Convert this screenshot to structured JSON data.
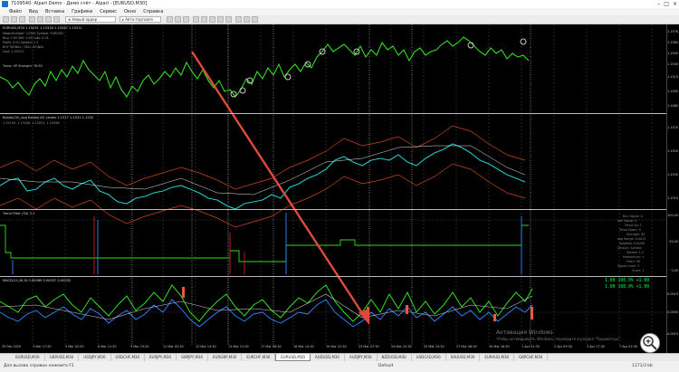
{
  "window": {
    "title": "7109540: Alpari Demo - Демо счёт - Alpari - [EURUSD,M30]",
    "buttons": [
      "–",
      "□",
      "×"
    ]
  },
  "menu": [
    "Файл",
    "Вид",
    "Вставка",
    "Графики",
    "Сервис",
    "Окно",
    "Справка"
  ],
  "toolbar": {
    "field1": "⊕ Новый ордер",
    "field2": "▸ Авто-торговля"
  },
  "panes": {
    "main_title": "EURUSD,M30  1.15291 1.15326 1.15287 1.15311",
    "main_info": [
      "MagicNumber: 12345  Symbol: EURUSD",
      "Buy: 0.00  Sell: 0.00  Lots: 0.01",
      "Profit: 0.00  Spread: 1.2",
      "BUY SIGNAL  / SELL SIGNAL",
      "Last: 1.15311",
      "Trend: UP  Strength: 78.63"
    ],
    "pane2_title": "Bands(20)_Avg  Bands(20) Levels  1.1517  1.1531  1.1532",
    "pane2_info": "1.15192, 1.15358, 1.15251, 1.15398",
    "pane3_title": "Trend Filter (30)  3 1",
    "pane3_legend": [
      "Buy Signal: 0",
      "Sell Signal: 0",
      "Trend Up: 1",
      "Trend Down: 0",
      "Strength: 62",
      "Avg Range: 0.0012",
      "Volatility: 0.0008",
      "Session: London",
      "Spread: 1.2",
      "Momentum: +",
      "Filter: OK",
      "Signal Level: 3",
      "Score: 1"
    ],
    "pane4_title": "MACD(12,26,9)  0.00089  0.00057  0.00032",
    "osc_values": [
      "1.00  100.0%  +1.00",
      "1.00  100.0%  +1.00"
    ]
  },
  "price_scale": [
    "1.1576",
    "1.1560",
    "1.1545",
    "1.1530",
    "1.1515",
    "1.1500",
    "1.1485"
  ],
  "pane2_scale": [
    "1.1570",
    "1.1550",
    "1.1530",
    "1.1510"
  ],
  "pane3_scale": [
    "100.00",
    "50.00",
    "0.00"
  ],
  "pane4_scale": [
    "0.0015",
    "0.0000",
    "-0.0015"
  ],
  "time_axis": [
    "29 Feb 2020",
    "3 Mar 17:30",
    "5 Mar 02:30",
    "6 Mar 11:30",
    "9 Mar 19:30",
    "11 Mar 05:30",
    "12 Mar 13:30",
    "13 Mar 21:30",
    "17 Mar 06:30",
    "18 Mar 14:30",
    "19 Mar 22:30",
    "23 Mar 07:30",
    "24 Mar 15:30",
    "25 Mar 23:30",
    "27 Mar 08:30",
    "30 Mar 16:30",
    "1 Apr 01:30",
    "2 Apr 09:30",
    "3 Apr 17:30",
    "7 Apr 02:30"
  ],
  "watermark": {
    "line1": "Активация Windows",
    "line2": "Чтобы активировать Windows, перейдите в раздел \"Параметры\"."
  },
  "tabs": [
    "EURUSD,M30",
    "GBPUSD,M30",
    "USDJPY,M30",
    "USDCHF,M30",
    "EURJPY,M30",
    "GBPJPY,M30",
    "EURGBP,M30",
    "EURCHF,M30",
    "EURUSD,M30",
    "AUDUSD,M30",
    "AUDJPY,M30",
    "NZDUSD,M30",
    "USDCAD,M30",
    "XAUUSD,M30",
    "EURAUD,M30",
    "GBPCHF,M30"
  ],
  "active_tab_index": 8,
  "status": {
    "help": "Для вызова справки нажмите F1",
    "profile": "Default",
    "bars": "1171/3 kb"
  },
  "colors": {
    "price_line": "#33dd22",
    "bands_line": "#22c8c8",
    "envelope_line": "#cc4422",
    "osc_green": "#33dd22",
    "osc_blue": "#3388ff",
    "arrow": "#e04a3c"
  }
}
